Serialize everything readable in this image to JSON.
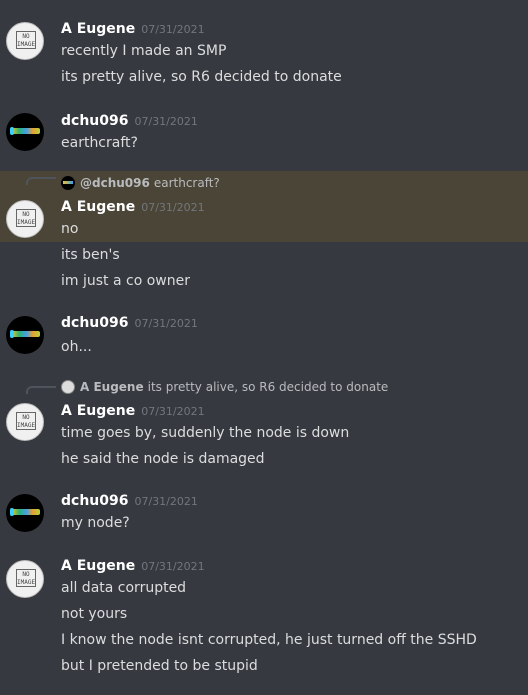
{
  "messages": [
    {
      "username": "A Eugene",
      "timestamp": "07/31/2021",
      "avatar": "no-image",
      "lines": [
        "recently I made an SMP",
        "its pretty alive, so R6 decided to donate"
      ]
    },
    {
      "username": "dchu096",
      "timestamp": "07/31/2021",
      "avatar": "dark",
      "lines": [
        "earthcraft?"
      ]
    },
    {
      "username": "A Eugene",
      "timestamp": "07/31/2021",
      "avatar": "no-image",
      "highlighted": true,
      "reply": {
        "name": "@dchu096",
        "text": "earthcraft?"
      },
      "lines": [
        "no",
        "its ben's",
        "im just a co owner"
      ]
    },
    {
      "username": "dchu096",
      "timestamp": "07/31/2021",
      "avatar": "dark",
      "lines": [
        "oh..."
      ]
    },
    {
      "username": "A Eugene",
      "timestamp": "07/31/2021",
      "avatar": "no-image",
      "reply": {
        "name": "A Eugene",
        "text": "its pretty alive, so R6 decided to donate"
      },
      "lines": [
        "time goes by, suddenly the node is down",
        "he said the node is damaged"
      ]
    },
    {
      "username": "dchu096",
      "timestamp": "07/31/2021",
      "avatar": "dark",
      "lines": [
        "my node?"
      ]
    },
    {
      "username": "A Eugene",
      "timestamp": "07/31/2021",
      "avatar": "no-image",
      "lines": [
        "all data corrupted",
        "not yours",
        "I know the node isnt corrupted, he just turned off the SSHD",
        "but I pretended to be stupid"
      ]
    }
  ],
  "avatar_text": {
    "no_image_line1": "NO",
    "no_image_line2": "IMAGE"
  },
  "colors": {
    "background": "#36393f",
    "highlight": "#4a4536",
    "username": "#ffffff",
    "text": "#dcddde",
    "timestamp": "#72767d"
  }
}
